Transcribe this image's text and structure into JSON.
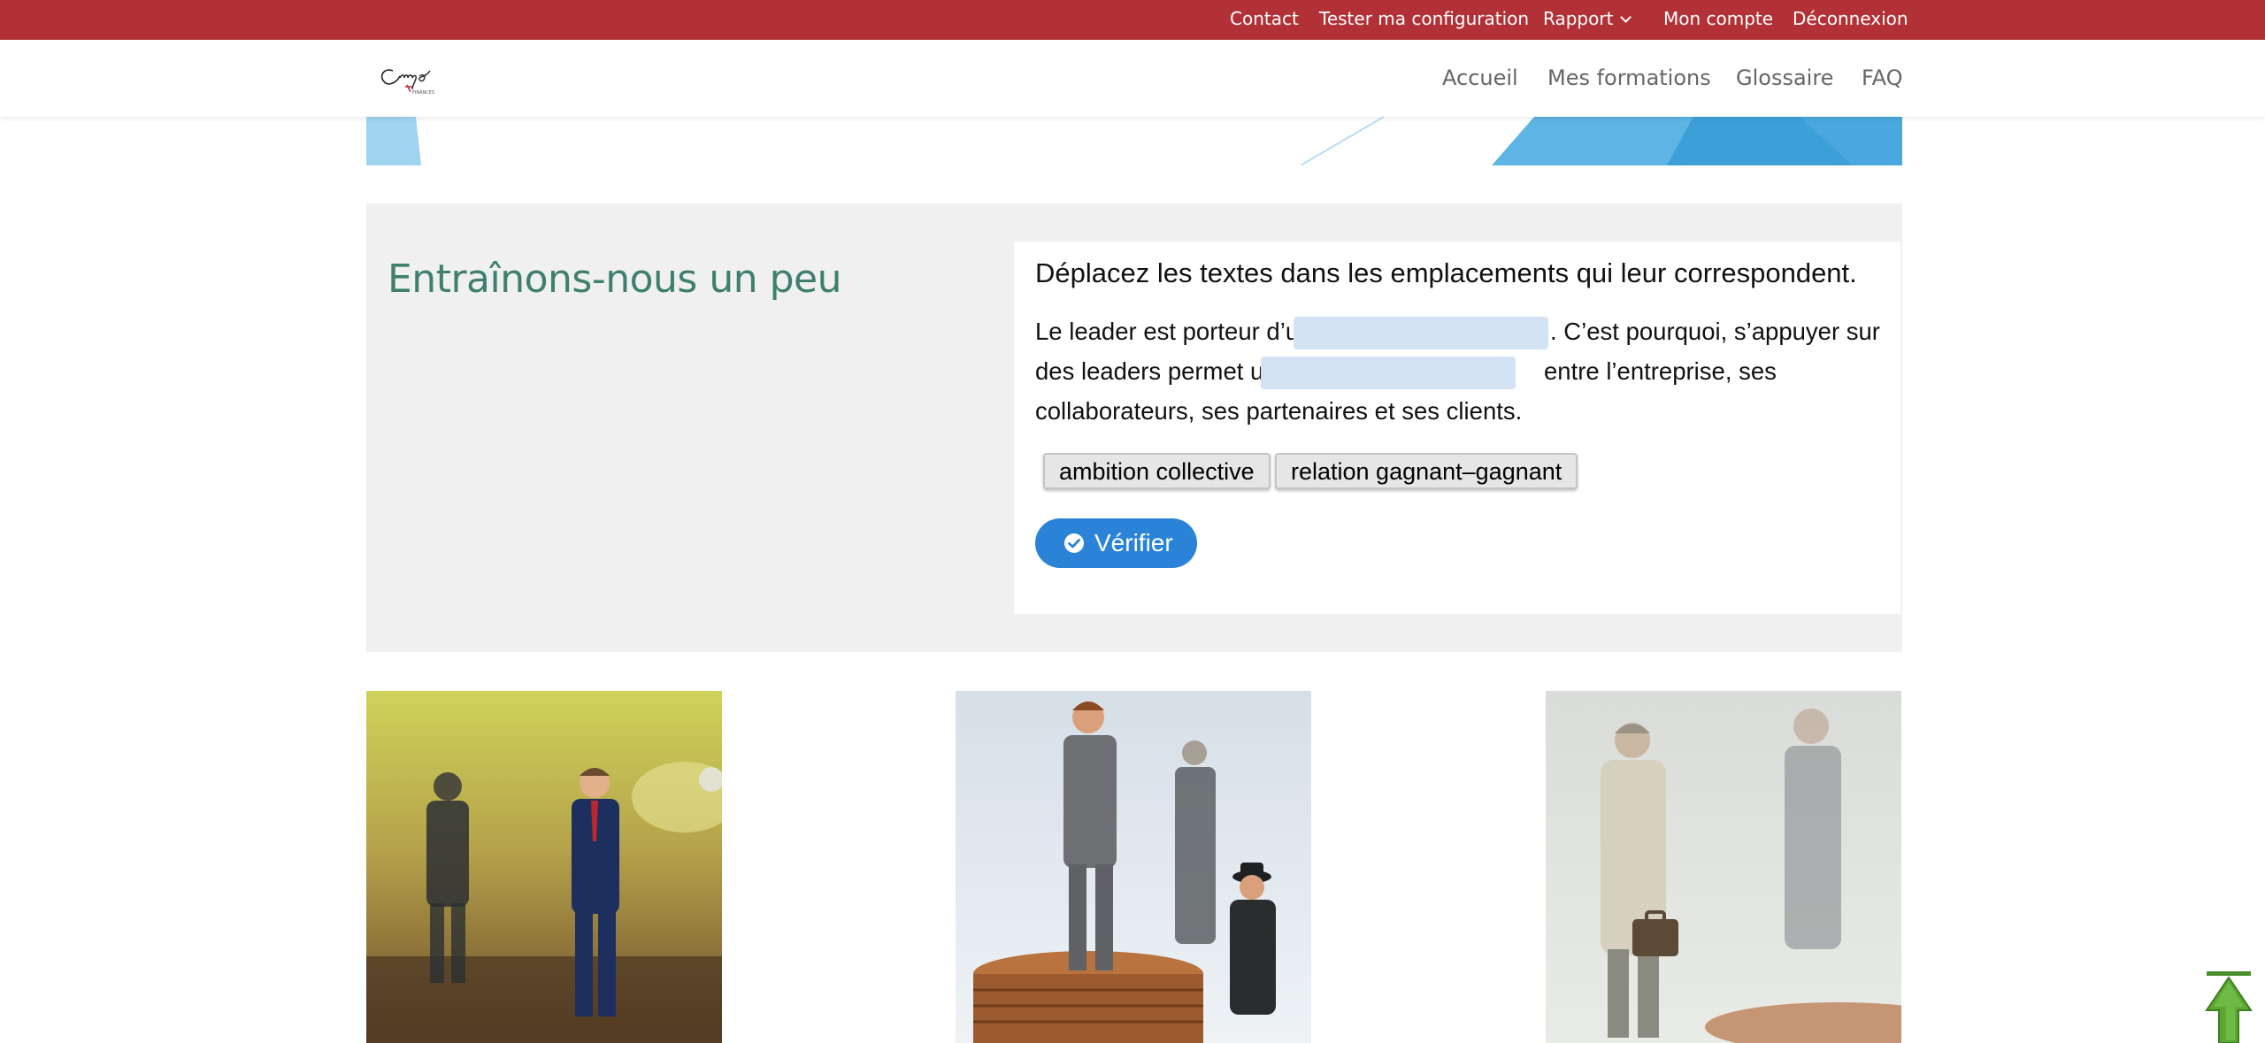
{
  "topbar": {
    "background": "#b23136",
    "links": [
      {
        "label": "Contact"
      },
      {
        "label": "Tester ma configuration"
      },
      {
        "label": "Rapport",
        "has_dropdown": true
      },
      {
        "label": "Mon compte"
      },
      {
        "label": "Déconnexion"
      }
    ]
  },
  "header": {
    "nav": [
      {
        "label": "Accueil"
      },
      {
        "label": "Mes formations"
      },
      {
        "label": "Glossaire"
      },
      {
        "label": "FAQ"
      }
    ]
  },
  "exercise": {
    "title": "Entraînons-nous un peu",
    "title_color": "#3e7f6e",
    "instruction": "Déplacez les textes dans les emplacements qui leur correspondent.",
    "sentence": {
      "part1": "Le leader est porteur d’une",
      "part2": ". C’est pourquoi, s’appuyer sur",
      "part3": "des leaders permet une",
      "part4": "entre l’entreprise, ses",
      "part5": "collaborateurs, ses partenaires et ses clients."
    },
    "drop_zone_color": "#d4e3f3",
    "draggables": [
      {
        "label": "ambition collective"
      },
      {
        "label": "relation gagnant–gagnant"
      }
    ],
    "verify_button": {
      "label": "Vérifier",
      "icon": "check-circle-icon",
      "color": "#2b83d8"
    }
  },
  "photos": [
    {
      "subject": "businessman-figurines-thinking"
    },
    {
      "subject": "businessman-figurines-on-coins"
    },
    {
      "subject": "figurine-with-briefcase"
    }
  ],
  "scroll_top": {
    "icon": "arrow-up-icon",
    "color": "#5aa832"
  }
}
